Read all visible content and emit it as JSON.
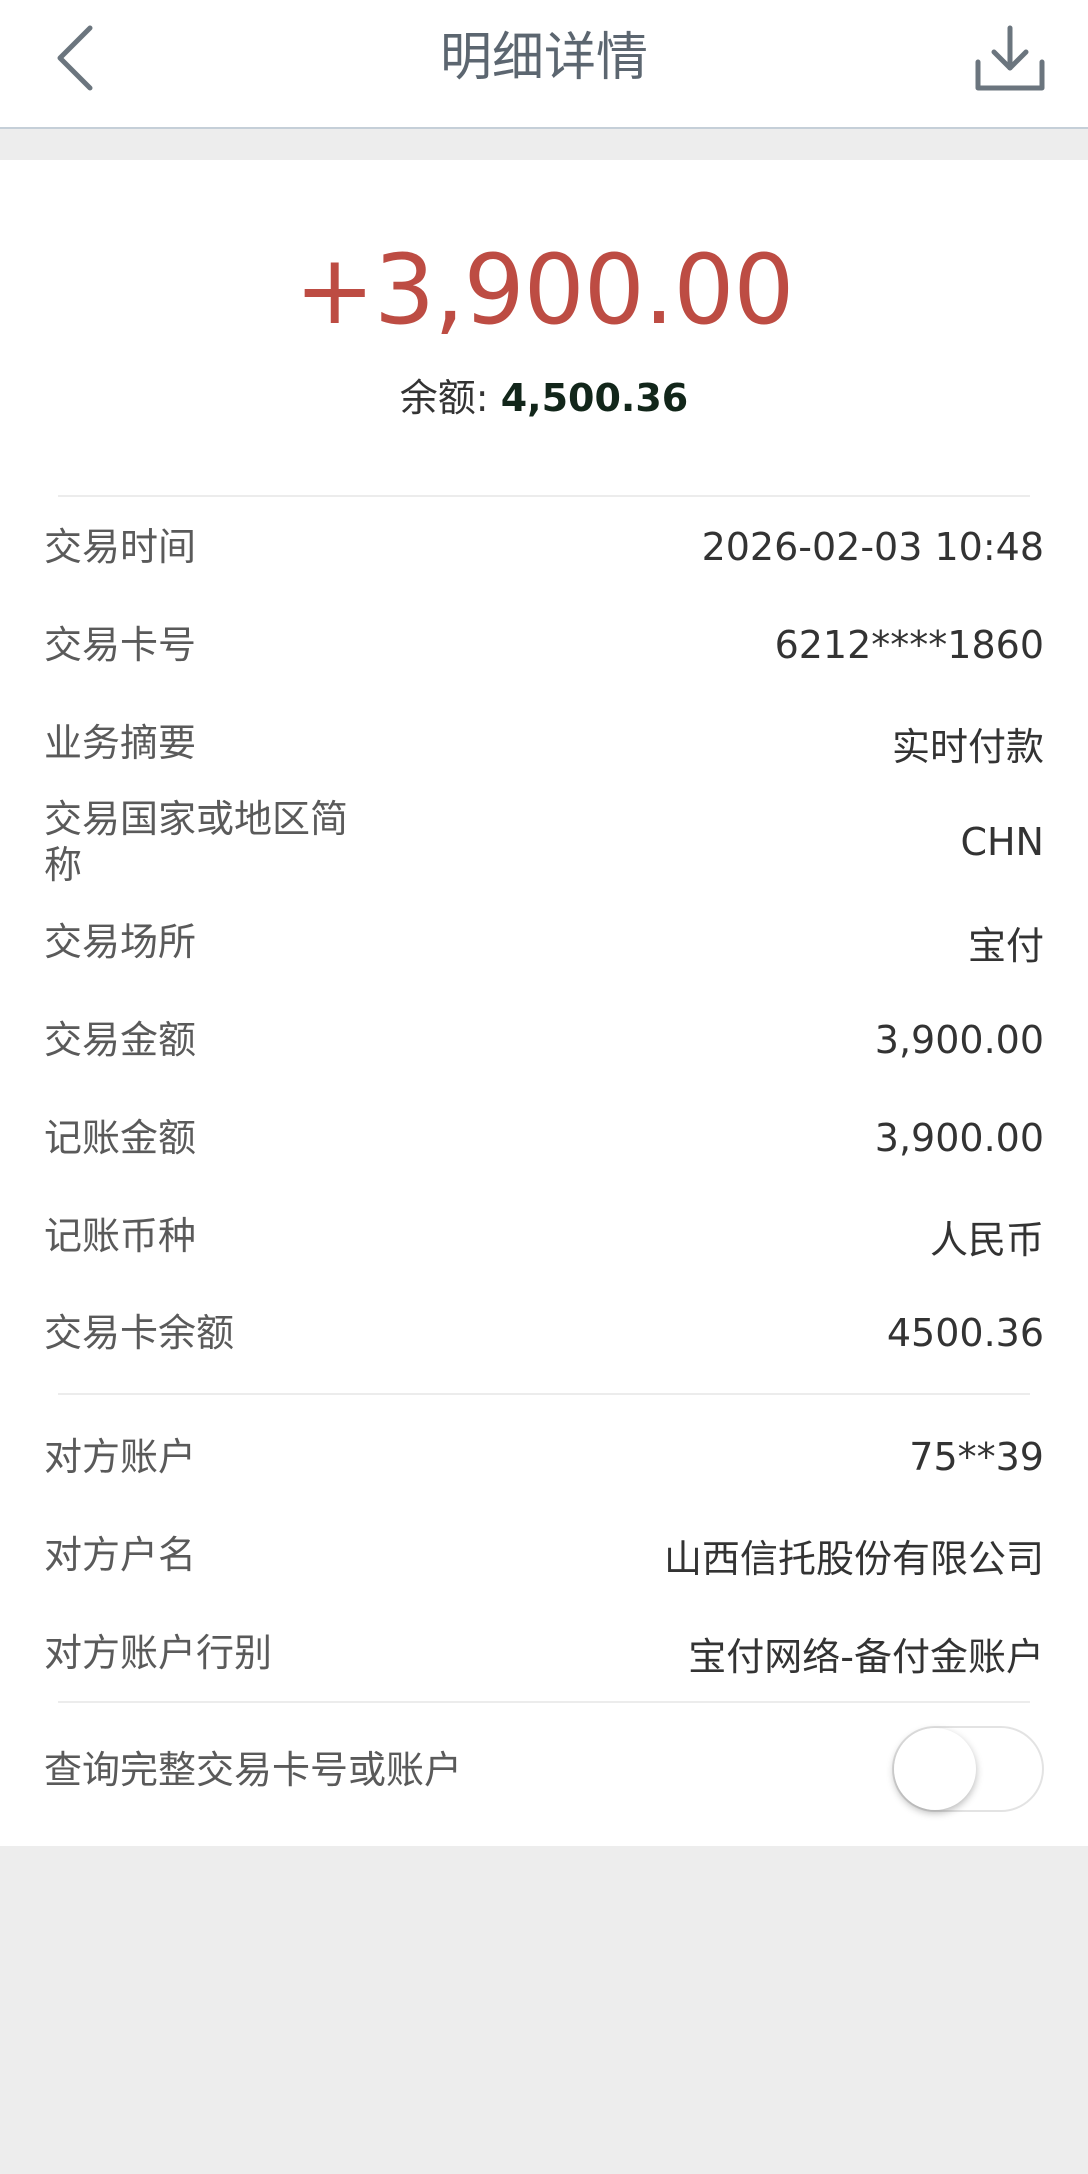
{
  "header": {
    "title": "明细详情"
  },
  "summary": {
    "amount": "+3,900.00",
    "balance_label": "余额: ",
    "balance_value": "4,500.36",
    "amount_color": "#bd4c43"
  },
  "details": [
    {
      "label": "交易时间",
      "value": "2026-02-03  10:48"
    },
    {
      "label": "交易卡号",
      "value": "6212****1860"
    },
    {
      "label": "业务摘要",
      "value": "实时付款"
    },
    {
      "label": "交易国家或地区简称",
      "value": "CHN"
    },
    {
      "label": "交易场所",
      "value": "宝付"
    },
    {
      "label": "交易金额",
      "value": "3,900.00"
    },
    {
      "label": "记账金额",
      "value": "3,900.00"
    },
    {
      "label": "记账币种",
      "value": "人民币"
    },
    {
      "label": "交易卡余额",
      "value": "4500.36"
    }
  ],
  "counterparty": [
    {
      "label": "对方账户",
      "value": "75**39"
    },
    {
      "label": "对方户名",
      "value": "山西信托股份有限公司"
    },
    {
      "label": "对方账户行别",
      "value": "宝付网络-备付金账户"
    }
  ],
  "query": {
    "label": "查询完整交易卡号或账户",
    "toggle_on": false
  },
  "icons": {
    "back": "chevron-left-icon",
    "download": "download-icon"
  }
}
